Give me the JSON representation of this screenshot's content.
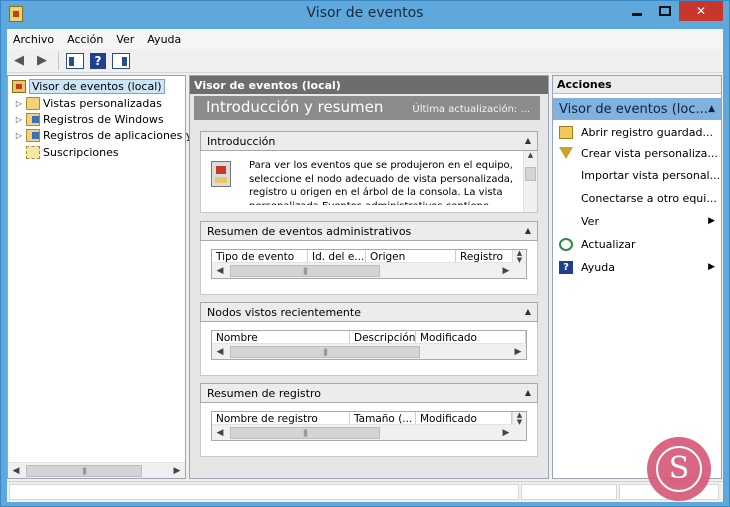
{
  "window": {
    "title": "Visor de eventos"
  },
  "menubar": {
    "items": [
      {
        "label": "Archivo"
      },
      {
        "label": "Acción"
      },
      {
        "label": "Ver"
      },
      {
        "label": "Ayuda"
      }
    ]
  },
  "toolbar": {
    "back_icon": "arrow-left-icon",
    "forward_icon": "arrow-right-icon",
    "show_tree_icon": "console-tree-icon",
    "help_icon": "help-icon",
    "help_glyph": "?",
    "show_actions_icon": "action-pane-icon"
  },
  "tree": {
    "items": [
      {
        "label": "Visor de eventos (local)",
        "icon": "event-viewer-icon",
        "selected": true
      },
      {
        "label": "Vistas personalizadas",
        "icon": "folder-icon"
      },
      {
        "label": "Registros de Windows",
        "icon": "logs-icon"
      },
      {
        "label": "Registros de aplicaciones y s",
        "icon": "logs-icon"
      },
      {
        "label": "Suscripciones",
        "icon": "subscriptions-icon"
      }
    ]
  },
  "center": {
    "header": "Visor de eventos (local)",
    "banner_title": "Introducción y resumen",
    "banner_updated": "Última actualización: ...",
    "sections": [
      {
        "title": "Introducción",
        "text": "Para ver los eventos que se produjeron en el equipo, seleccione el nodo adecuado de vista personalizada, registro u origen en el árbol de la consola. La vista personalizada Eventos administrativos contiene todos"
      },
      {
        "title": "Resumen de eventos administrativos",
        "columns": [
          "Tipo de evento",
          "Id. del e...",
          "Origen",
          "Registro"
        ]
      },
      {
        "title": "Nodos vistos recientemente",
        "columns": [
          "Nombre",
          "Descripción",
          "Modificado"
        ]
      },
      {
        "title": "Resumen de registro",
        "columns": [
          "Nombre de registro",
          "Tamaño (...",
          "Modificado"
        ]
      }
    ]
  },
  "actions": {
    "header": "Acciones",
    "group": "Visor de eventos (loc...",
    "items": [
      {
        "label": "Abrir registro guardad...",
        "icon": "open-folder-icon"
      },
      {
        "label": "Crear vista personaliza...",
        "icon": "filter-icon"
      },
      {
        "label": "Importar vista personal...",
        "icon": ""
      },
      {
        "label": "Conectarse a otro equi...",
        "icon": ""
      },
      {
        "label": "Ver",
        "icon": "",
        "submenu": true
      },
      {
        "label": "Actualizar",
        "icon": "refresh-icon"
      },
      {
        "label": "Ayuda",
        "icon": "help-icon",
        "submenu": true
      }
    ]
  },
  "colors": {
    "titlebar": "#5ea8dc",
    "close_button": "#c7372e",
    "selection": "#cde6f7",
    "actions_group": "#7fb2de",
    "watermark": "#d65a78"
  },
  "watermark": {
    "glyph": "S"
  }
}
